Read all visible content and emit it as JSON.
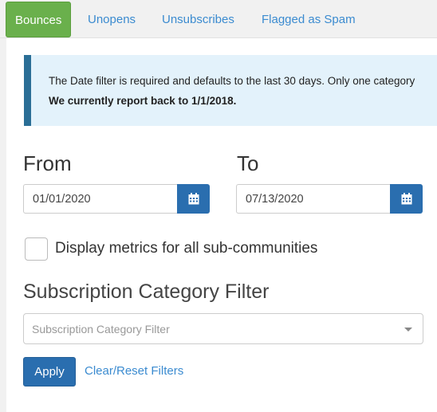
{
  "tabs": [
    {
      "label": "Bounces",
      "active": true
    },
    {
      "label": "Unopens",
      "active": false
    },
    {
      "label": "Unsubscribes",
      "active": false
    },
    {
      "label": "Flagged as Spam",
      "active": false
    }
  ],
  "notice": {
    "line1": "The Date filter is required and defaults to the last 30 days. Only one category",
    "line2": "We currently report back to 1/1/2018."
  },
  "dates": {
    "from_label": "From",
    "from_value": "01/01/2020",
    "to_label": "To",
    "to_value": "07/13/2020",
    "icon": "calendar-icon"
  },
  "subcommunities": {
    "label": "Display metrics for all sub-communities",
    "checked": false
  },
  "category_filter": {
    "title": "Subscription Category Filter",
    "placeholder": "Subscription Category Filter"
  },
  "actions": {
    "apply_label": "Apply",
    "reset_label": "Clear/Reset Filters"
  },
  "colors": {
    "active_tab": "#6ab04c",
    "primary": "#2a6eaf",
    "link": "#3b8bd0",
    "notice_bg": "#e3f2fb",
    "notice_border": "#2a6e96"
  }
}
